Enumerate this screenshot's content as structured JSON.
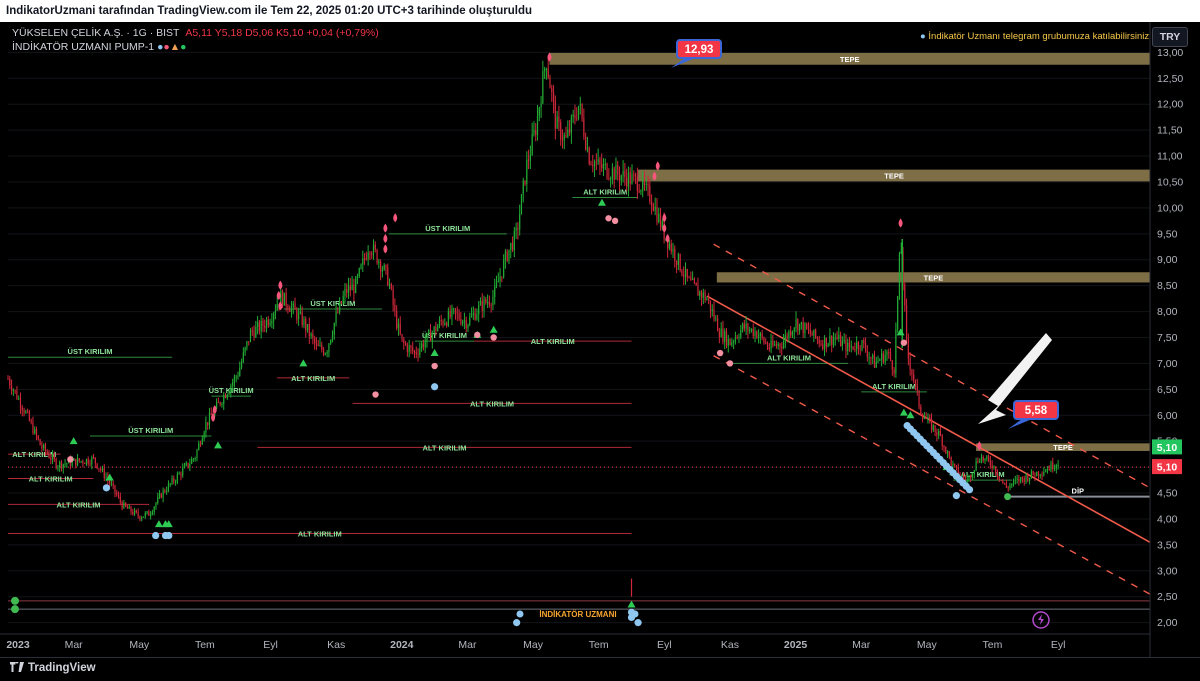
{
  "header": {
    "title": "IndikatorUzmani tarafından TradingView.com ile Tem 22, 2025 01:20 UTC+3 tarihinde oluşturuldu",
    "symbol_line": "YÜKSELEN ÇELİK A.Ş. · 1G · BIST",
    "ohlc": "A5,11  Y5,18  D5,06  K5,10  +0,04 (+0,79%)",
    "indicator_line": "İNDİKATÖR UZMANI PUMP-1",
    "telegram_note": "İndikatör Uzmanı telegram grubumuza katılabilirsiniz !!!",
    "currency": "TRY",
    "brand": "TradingView",
    "watermark": "İNDİKATÖR UZMANI"
  },
  "colors": {
    "up": "#22ab34",
    "down": "#d0283a",
    "zone": "#8c7a4e",
    "trend": "#f05a4a",
    "signal_pink": "#f7567c",
    "signal_blue": "#8fc7f0",
    "last_green": "#22c55e",
    "last_red": "#f23645"
  },
  "chart_data": {
    "type": "candlestick",
    "y_axis": {
      "min": 1.8,
      "max": 13.2,
      "ticks": [
        "2,00",
        "2,50",
        "3,00",
        "3,50",
        "4,00",
        "4,50",
        "5,00",
        "5,50",
        "6,00",
        "6,50",
        "7,00",
        "7,50",
        "8,00",
        "8,50",
        "9,00",
        "9,50",
        "10,00",
        "10,50",
        "11,00",
        "11,50",
        "12,00",
        "12,50",
        "13,00"
      ]
    },
    "x_axis": {
      "labels": [
        "2023",
        "Mar",
        "May",
        "Tem",
        "Eyl",
        "Kas",
        "2024",
        "Mar",
        "May",
        "Tem",
        "Eyl",
        "Kas",
        "2025",
        "Mar",
        "May",
        "Tem",
        "Eyl"
      ]
    },
    "last_price": "5,10",
    "last_price_label_2": "5,10",
    "price_path": [
      [
        0,
        6.7
      ],
      [
        0.5,
        6.1
      ],
      [
        1.0,
        5.4
      ],
      [
        1.5,
        5.05
      ],
      [
        2.0,
        5.1
      ],
      [
        2.6,
        5.15
      ],
      [
        3.0,
        4.8
      ],
      [
        3.5,
        4.25
      ],
      [
        4.0,
        4.05
      ],
      [
        4.3,
        4.1
      ],
      [
        4.7,
        4.5
      ],
      [
        5.2,
        4.85
      ],
      [
        5.7,
        5.2
      ],
      [
        6.0,
        5.8
      ],
      [
        6.5,
        6.3
      ],
      [
        7.0,
        6.8
      ],
      [
        7.4,
        7.6
      ],
      [
        7.7,
        7.7
      ],
      [
        8.0,
        7.9
      ],
      [
        8.3,
        8.3
      ],
      [
        8.6,
        8.1
      ],
      [
        9.0,
        7.8
      ],
      [
        9.4,
        7.3
      ],
      [
        9.7,
        7.25
      ],
      [
        10.0,
        7.9
      ],
      [
        10.3,
        8.4
      ],
      [
        10.6,
        8.5
      ],
      [
        11.0,
        9.3
      ],
      [
        11.3,
        9.0
      ],
      [
        11.6,
        8.6
      ],
      [
        11.8,
        7.9
      ],
      [
        12.0,
        7.4
      ],
      [
        12.4,
        7.2
      ],
      [
        12.8,
        7.5
      ],
      [
        13.2,
        7.8
      ],
      [
        13.6,
        7.95
      ],
      [
        14.0,
        7.8
      ],
      [
        14.4,
        8.1
      ],
      [
        14.8,
        8.3
      ],
      [
        15.2,
        9.1
      ],
      [
        15.5,
        9.5
      ],
      [
        15.8,
        10.8
      ],
      [
        16.1,
        11.6
      ],
      [
        16.4,
        12.9
      ],
      [
        16.7,
        11.6
      ],
      [
        17.0,
        11.3
      ],
      [
        17.4,
        12.0
      ],
      [
        17.7,
        11.0
      ],
      [
        18.0,
        10.8
      ],
      [
        18.4,
        10.7
      ],
      [
        18.8,
        10.6
      ],
      [
        19.2,
        10.5
      ],
      [
        19.6,
        10.2
      ],
      [
        20.0,
        9.5
      ],
      [
        20.4,
        9.0
      ],
      [
        20.7,
        8.6
      ],
      [
        21.0,
        8.4
      ],
      [
        21.3,
        8.25
      ],
      [
        21.7,
        7.6
      ],
      [
        22.0,
        7.4
      ],
      [
        22.4,
        7.7
      ],
      [
        22.8,
        7.6
      ],
      [
        23.2,
        7.3
      ],
      [
        23.6,
        7.4
      ],
      [
        24.0,
        7.8
      ],
      [
        24.4,
        7.6
      ],
      [
        24.8,
        7.4
      ],
      [
        25.2,
        7.5
      ],
      [
        25.6,
        7.3
      ],
      [
        26.0,
        7.4
      ],
      [
        26.4,
        7.0
      ],
      [
        26.8,
        7.2
      ],
      [
        27.0,
        6.9
      ],
      [
        27.2,
        9.4
      ],
      [
        27.4,
        7.2
      ],
      [
        27.6,
        6.7
      ],
      [
        27.8,
        6.1
      ],
      [
        28.0,
        5.9
      ],
      [
        28.4,
        5.6
      ],
      [
        28.8,
        5.0
      ],
      [
        29.2,
        4.7
      ],
      [
        29.6,
        5.2
      ],
      [
        30.0,
        5.05
      ],
      [
        30.4,
        4.6
      ],
      [
        30.8,
        4.75
      ],
      [
        31.2,
        4.85
      ],
      [
        31.6,
        4.95
      ],
      [
        32.0,
        5.1
      ]
    ],
    "zones": [
      {
        "label": "TEPE",
        "x1": 16.5,
        "x2": 34.8,
        "y1": 12.8,
        "y2": 12.95
      },
      {
        "label": "TEPE",
        "x1": 19.2,
        "x2": 34.8,
        "y1": 10.55,
        "y2": 10.7
      },
      {
        "label": "TEPE",
        "x1": 21.6,
        "x2": 34.8,
        "y1": 8.6,
        "y2": 8.72
      },
      {
        "label": "TEPE",
        "x1": 29.5,
        "x2": 34.8,
        "y1": 5.35,
        "y2": 5.42
      }
    ],
    "levels": [
      {
        "label": "ÜST KIRILIM",
        "x1": 0,
        "x2": 5.0,
        "y": 7.12,
        "color": "green"
      },
      {
        "label": "ÜST KIRILIM",
        "x1": 2.5,
        "x2": 6.2,
        "y": 5.6,
        "color": "green"
      },
      {
        "label": "ÜST KIRILIM",
        "x1": 6.2,
        "x2": 7.4,
        "y": 6.37,
        "color": "green"
      },
      {
        "label": "ÜST KIRILIM",
        "x1": 8.4,
        "x2": 11.4,
        "y": 8.05,
        "color": "green"
      },
      {
        "label": "ÜST KIRILIM",
        "x1": 11.6,
        "x2": 15.2,
        "y": 9.5,
        "color": "green"
      },
      {
        "label": "ÜST KIRILIM",
        "x1": 12.4,
        "x2": 14.2,
        "y": 7.43,
        "color": "green"
      },
      {
        "label": "ALT KIRILIM",
        "x1": 0,
        "x2": 1.6,
        "y": 5.25,
        "color": "red"
      },
      {
        "label": "ALT KIRILIM",
        "x1": 0,
        "x2": 2.6,
        "y": 4.78,
        "color": "red"
      },
      {
        "label": "ALT KIRILIM",
        "x1": 0,
        "x2": 4.3,
        "y": 4.28,
        "color": "red"
      },
      {
        "label": "ALT KIRILIM",
        "x1": 0,
        "x2": 19.0,
        "y": 3.72,
        "color": "red"
      },
      {
        "label": "ALT KIRILIM",
        "x1": 7.6,
        "x2": 19.0,
        "y": 5.38,
        "color": "red"
      },
      {
        "label": "ALT KIRILIM",
        "x1": 8.2,
        "x2": 10.4,
        "y": 6.72,
        "color": "red"
      },
      {
        "label": "ALT KIRILIM",
        "x1": 10.5,
        "x2": 19.0,
        "y": 6.23,
        "color": "red"
      },
      {
        "label": "ALT KIRILIM",
        "x1": 14.2,
        "x2": 19.0,
        "y": 7.43,
        "color": "red"
      },
      {
        "label": "ALT KIRILIM",
        "x1": 17.2,
        "x2": 19.2,
        "y": 10.2,
        "color": "green"
      },
      {
        "label": "ALT KIRILIM",
        "x1": 22.0,
        "x2": 25.6,
        "y": 7.0,
        "color": "green"
      },
      {
        "label": "ALT KIRILIM",
        "x1": 26.0,
        "x2": 28.0,
        "y": 6.45,
        "color": "green"
      },
      {
        "label": "ALT KIRILIM",
        "x1": 28.8,
        "x2": 30.6,
        "y": 4.75,
        "color": "green"
      },
      {
        "label": "DİP",
        "x1": 30.4,
        "x2": 34.8,
        "y": 4.43,
        "color": "gray"
      }
    ],
    "callouts": [
      {
        "label": "12,93",
        "x": 16.7,
        "y": 12.93
      },
      {
        "label": "5,58",
        "x": 29.6,
        "y": 5.58
      }
    ]
  }
}
